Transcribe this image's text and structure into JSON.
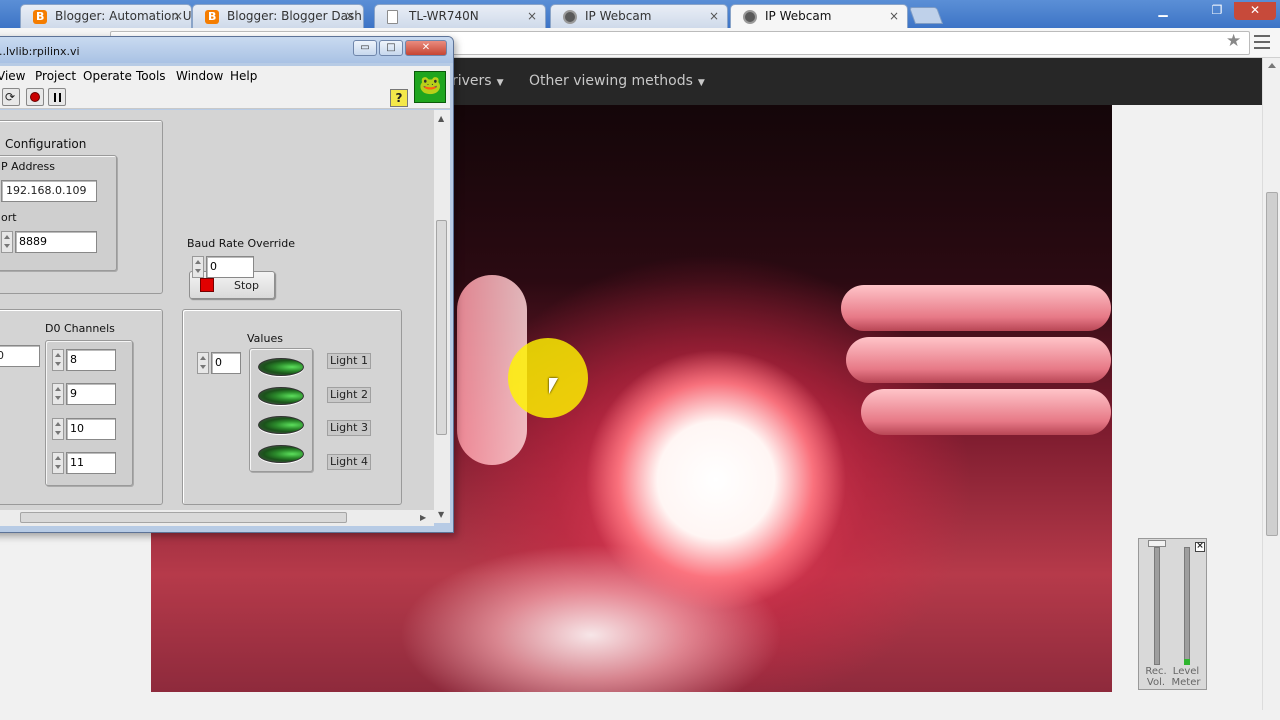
{
  "browser": {
    "tabs": [
      {
        "label": "Blogger: Automation Usir",
        "icon": "blogger-icon"
      },
      {
        "label": "Blogger: Blogger Dashbo",
        "icon": "blogger-icon"
      },
      {
        "label": "TL-WR740N",
        "icon": "document-icon"
      },
      {
        "label": "IP Webcam",
        "icon": "webcam-icon"
      },
      {
        "label": "IP Webcam",
        "icon": "webcam-icon",
        "active": true
      }
    ],
    "window_controls": {
      "minimize": "▁",
      "maximize": "❐",
      "close": "✕"
    },
    "tab_close_glyph": "×",
    "star_glyph": "★"
  },
  "site": {
    "nav": [
      {
        "label": "rivers"
      },
      {
        "label": "Other viewing methods"
      }
    ],
    "caret_glyph": "▼"
  },
  "audio_meter": {
    "rec_label": "Rec. Vol.",
    "level_label": "Level Meter",
    "close_glyph": "×",
    "level_fraction": 0.05
  },
  "labview": {
    "title": "..lvlib:rpilinx.vi",
    "title_buttons": {
      "minimize": "▭",
      "maximize": "□",
      "close": "✕"
    },
    "menu": [
      "View",
      "Project",
      "Operate",
      "Tools",
      "Window",
      "Help"
    ],
    "help_glyph": "?",
    "run_glyph": "⟳",
    "configuration": {
      "label": "Configuration",
      "ip_label": "P Address",
      "ip_value": "192.168.0.109",
      "port_label": "ort",
      "port_value": "8889"
    },
    "stop_label": "Stop",
    "baud": {
      "label": "Baud Rate Override",
      "value": "0"
    },
    "d0": {
      "label": "D0 Channels",
      "left_value": "0",
      "channels": [
        "8",
        "9",
        "10",
        "11"
      ]
    },
    "values": {
      "label": "Values",
      "index": "0",
      "lights": [
        "Light 1",
        "Light 2",
        "Light 3",
        "Light 4"
      ]
    }
  }
}
